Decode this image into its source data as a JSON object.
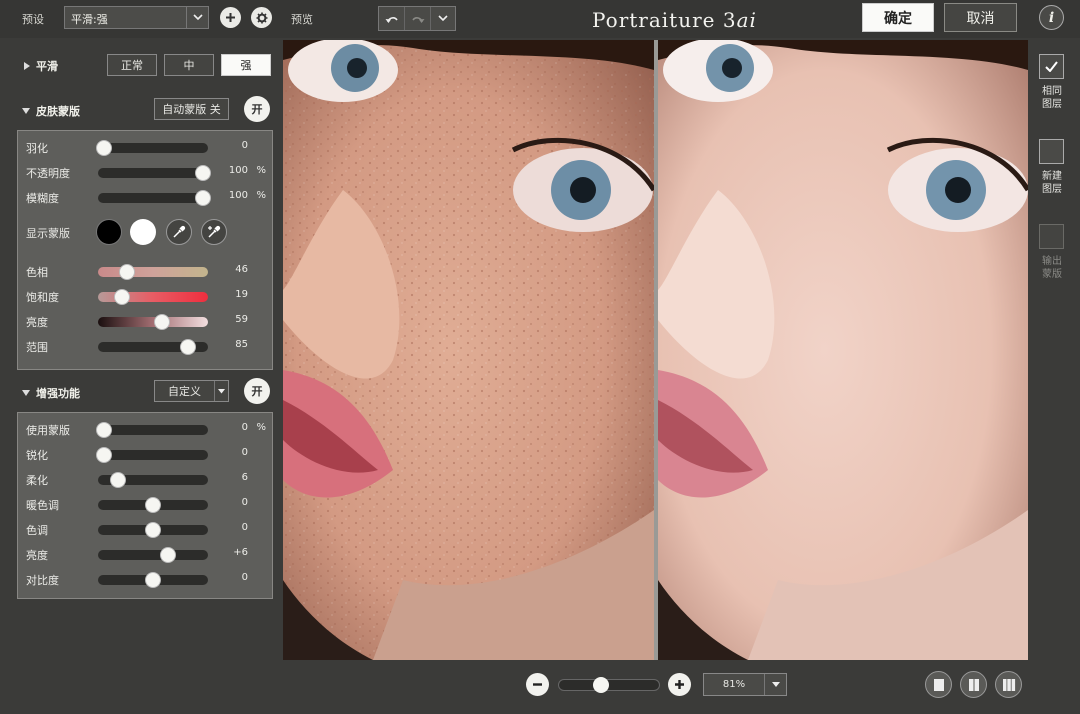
{
  "header": {
    "preset_label": "预设",
    "preset_value": "平滑:强",
    "preview_label": "预览",
    "logo_main": "Portraiture 3",
    "logo_suffix": "ai",
    "ok_label": "确定",
    "cancel_label": "取消",
    "info_glyph": "i"
  },
  "smoothing": {
    "title": "平滑",
    "options": [
      "正常",
      "中",
      "强"
    ],
    "selected": "强"
  },
  "skin_mask": {
    "title": "皮肤蒙版",
    "auto_mask_label": "自动蒙版 关",
    "toggle_label": "开",
    "sliders": [
      {
        "name": "羽化",
        "value": "0",
        "unit": "",
        "pos": 0.05
      },
      {
        "name": "不透明度",
        "value": "100",
        "unit": "%",
        "pos": 0.95
      },
      {
        "name": "模糊度",
        "value": "100",
        "unit": "%",
        "pos": 0.95
      }
    ],
    "show_mask_label": "显示蒙版",
    "color_sliders": [
      {
        "name": "色相",
        "value": "46",
        "pos": 0.26
      },
      {
        "name": "饱和度",
        "value": "19",
        "pos": 0.22
      },
      {
        "name": "亮度",
        "value": "59",
        "pos": 0.58
      },
      {
        "name": "范围",
        "value": "85",
        "pos": 0.82
      }
    ]
  },
  "enhancements": {
    "title": "增强功能",
    "dropdown_value": "自定义",
    "toggle_label": "开",
    "sliders": [
      {
        "name": "使用蒙版",
        "value": "0",
        "unit": "%",
        "pos": 0.05
      },
      {
        "name": "锐化",
        "value": "0",
        "unit": "",
        "pos": 0.05
      },
      {
        "name": "柔化",
        "value": "6",
        "unit": "",
        "pos": 0.18
      },
      {
        "name": "暖色调",
        "value": "0",
        "unit": "",
        "pos": 0.5
      },
      {
        "name": "色调",
        "value": "0",
        "unit": "",
        "pos": 0.5
      },
      {
        "name": "亮度",
        "value": "+6",
        "unit": "",
        "pos": 0.64
      },
      {
        "name": "对比度",
        "value": "0",
        "unit": "",
        "pos": 0.5
      }
    ]
  },
  "side": {
    "same_layer": [
      "相同",
      "图层"
    ],
    "new_layer": [
      "新建",
      "图层"
    ],
    "output_mask": [
      "输出",
      "蒙版"
    ]
  },
  "zoom": {
    "value": "81%",
    "slider_pos": 0.4
  },
  "colors": {
    "background": "#3b3b39",
    "panel_box": "#5e5e5b",
    "accent_white": "#fafaf8"
  }
}
